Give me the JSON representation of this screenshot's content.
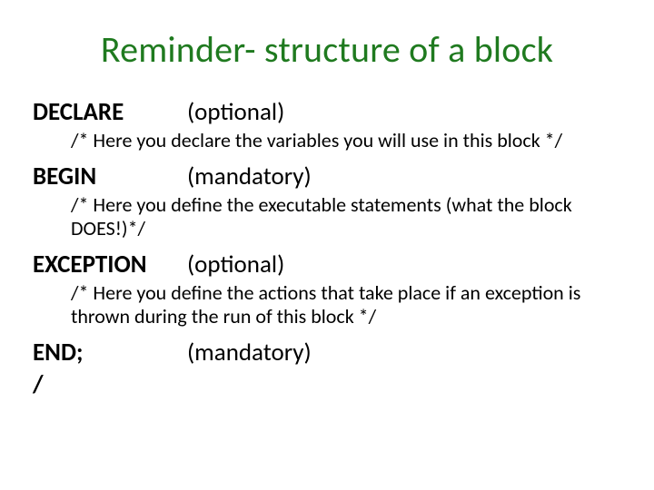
{
  "title": "Reminder- structure of a block",
  "sections": [
    {
      "keyword": "DECLARE",
      "note": "(optional)",
      "comment": "/* Here you declare the variables you will use in this block */"
    },
    {
      "keyword": "BEGIN",
      "note": "(mandatory)",
      "comment": "/* Here you define the executable statements (what the block DOES!)*/"
    },
    {
      "keyword": "EXCEPTION",
      "note": "(optional)",
      "comment": "/* Here you define the actions that take place if an exception is thrown during the run of this block */"
    },
    {
      "keyword": "END;",
      "note": "(mandatory)",
      "comment": ""
    }
  ],
  "terminator": "/"
}
